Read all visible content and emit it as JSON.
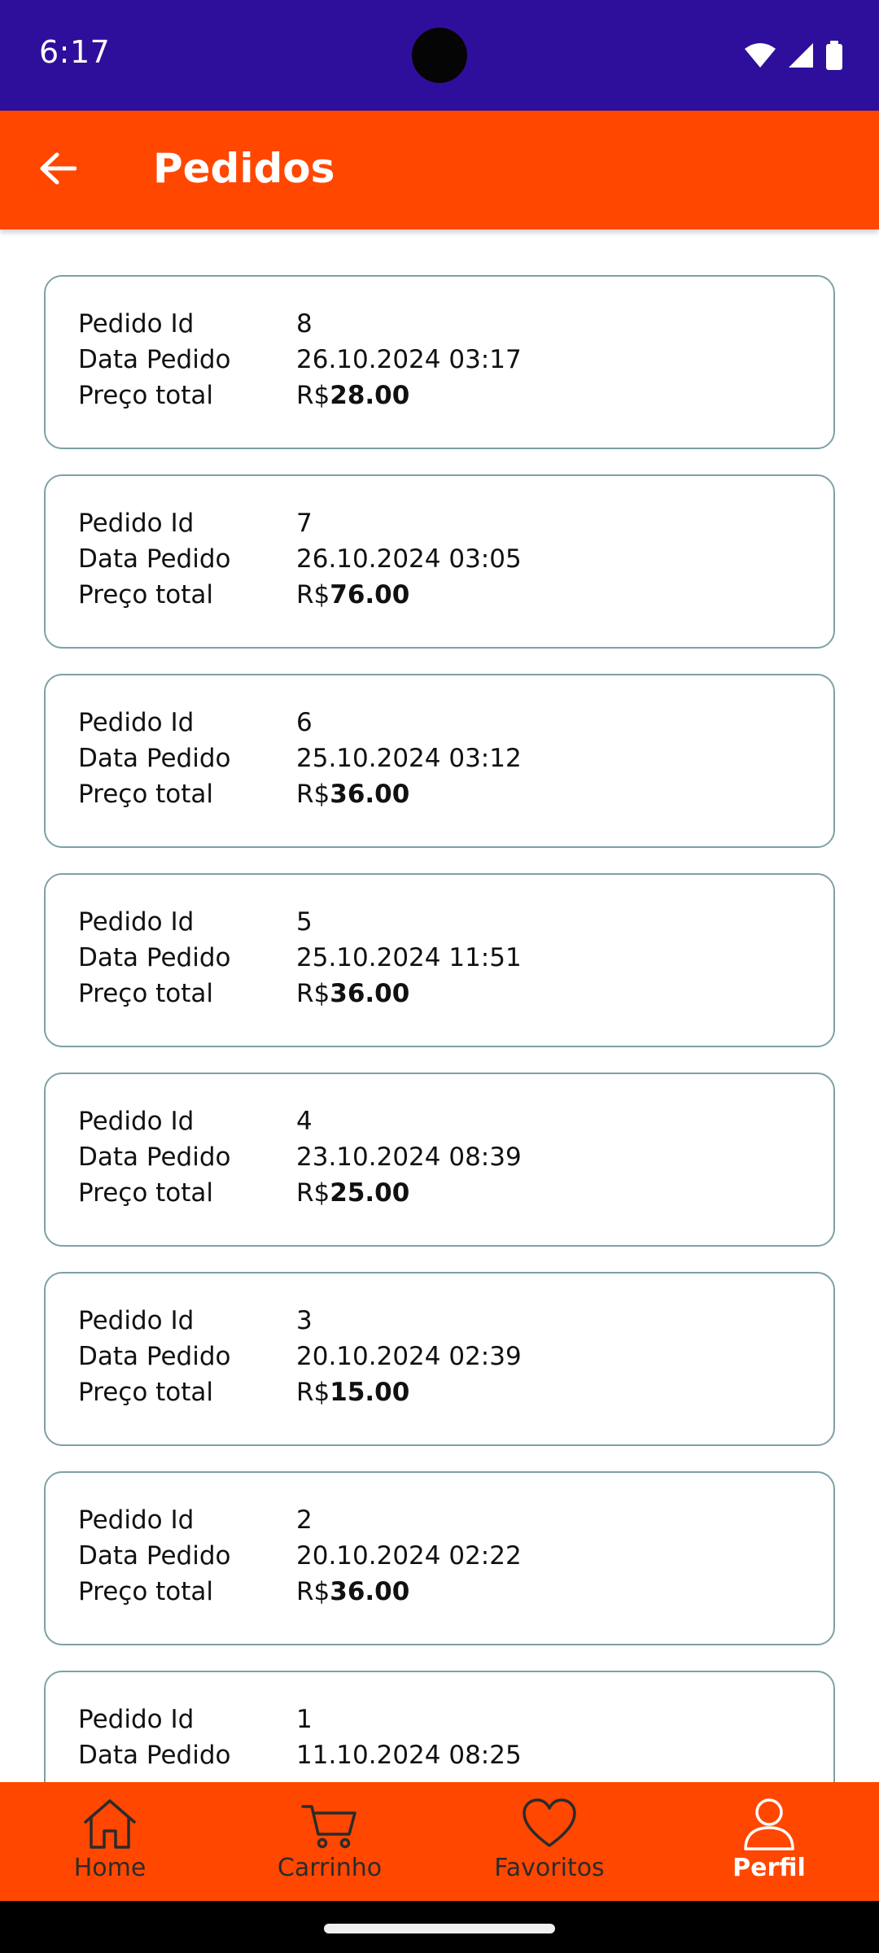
{
  "status_bar": {
    "time": "6:17"
  },
  "app_bar": {
    "title": "Pedidos"
  },
  "orders": [
    {
      "id_label": "Pedido Id",
      "id": "8",
      "date_label": "Data Pedido",
      "date": "26.10.2024 03:17",
      "price_label": "Preço total",
      "currency": "R$",
      "price": "28.00"
    },
    {
      "id_label": "Pedido Id",
      "id": "7",
      "date_label": "Data Pedido",
      "date": "26.10.2024 03:05",
      "price_label": "Preço total",
      "currency": "R$",
      "price": "76.00"
    },
    {
      "id_label": "Pedido Id",
      "id": "6",
      "date_label": "Data Pedido",
      "date": "25.10.2024 03:12",
      "price_label": "Preço total",
      "currency": "R$",
      "price": "36.00"
    },
    {
      "id_label": "Pedido Id",
      "id": "5",
      "date_label": "Data Pedido",
      "date": "25.10.2024 11:51",
      "price_label": "Preço total",
      "currency": "R$",
      "price": "36.00"
    },
    {
      "id_label": "Pedido Id",
      "id": "4",
      "date_label": "Data Pedido",
      "date": "23.10.2024 08:39",
      "price_label": "Preço total",
      "currency": "R$",
      "price": "25.00"
    },
    {
      "id_label": "Pedido Id",
      "id": "3",
      "date_label": "Data Pedido",
      "date": "20.10.2024 02:39",
      "price_label": "Preço total",
      "currency": "R$",
      "price": "15.00"
    },
    {
      "id_label": "Pedido Id",
      "id": "2",
      "date_label": "Data Pedido",
      "date": "20.10.2024 02:22",
      "price_label": "Preço total",
      "currency": "R$",
      "price": "36.00"
    },
    {
      "id_label": "Pedido Id",
      "id": "1",
      "date_label": "Data Pedido",
      "date": "11.10.2024 08:25"
    }
  ],
  "bottom_nav": {
    "items": [
      {
        "label": "Home",
        "icon": "home-icon"
      },
      {
        "label": "Carrinho",
        "icon": "cart-icon"
      },
      {
        "label": "Favoritos",
        "icon": "heart-icon"
      },
      {
        "label": "Perfil",
        "icon": "profile-icon",
        "active": true
      }
    ]
  },
  "colors": {
    "status_bar": "#2e0f9c",
    "accent": "#ff4700",
    "card_border": "#7fa0a6"
  }
}
